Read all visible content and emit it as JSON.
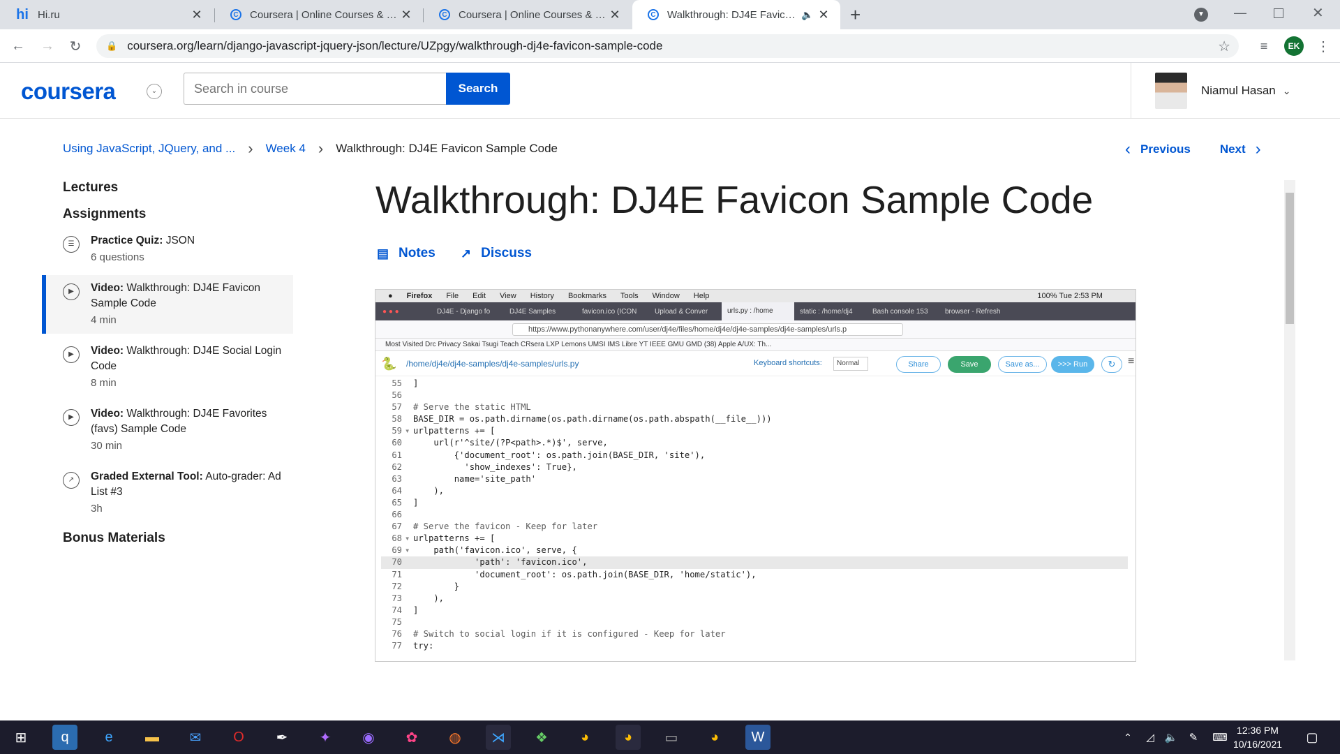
{
  "browser": {
    "tabs": [
      {
        "title": "Hi.ru",
        "favicon": "hi-logo"
      },
      {
        "title": "Coursera | Online Courses & Credentials",
        "favicon": "coursera-icon"
      },
      {
        "title": "Coursera | Online Courses & Credentials",
        "favicon": "coursera-icon"
      },
      {
        "title": "Walkthrough: DJ4E Favicon Sample Code",
        "favicon": "coursera-icon",
        "active": true
      }
    ],
    "url": "coursera.org/learn/django-javascript-jquery-json/lecture/UZpgy/walkthrough-dj4e-favicon-sample-code",
    "profile_initials": "EK"
  },
  "header": {
    "logo": "coursera",
    "search_placeholder": "Search in course",
    "search_button": "Search",
    "user_name": "Niamul Hasan"
  },
  "breadcrumb": {
    "course": "Using JavaScript, JQuery, and ...",
    "week": "Week 4",
    "current": "Walkthrough: DJ4E Favicon Sample Code"
  },
  "nav": {
    "previous": "Previous",
    "next": "Next"
  },
  "sidebar": {
    "lectures": "Lectures",
    "assignments": "Assignments",
    "bonus": "Bonus Materials",
    "items": [
      {
        "type": "Practice Quiz:",
        "name": "JSON",
        "meta": "6 questions",
        "icon": "quiz-icon"
      },
      {
        "type": "Video:",
        "name": "Walkthrough: DJ4E Favicon Sample Code",
        "meta": "4 min",
        "icon": "play-icon",
        "active": true
      },
      {
        "type": "Video:",
        "name": "Walkthrough: DJ4E Social Login Code",
        "meta": "8 min",
        "icon": "play-icon"
      },
      {
        "type": "Video:",
        "name": "Walkthrough: DJ4E Favorites (favs) Sample Code",
        "meta": "30 min",
        "icon": "play-icon"
      },
      {
        "type": "Graded External Tool:",
        "name": "Auto-grader: Ad List #3",
        "meta": "3h",
        "icon": "external-tool-icon"
      }
    ]
  },
  "main": {
    "title": "Walkthrough: DJ4E Favicon Sample Code",
    "notes": "Notes",
    "discuss": "Discuss"
  },
  "video": {
    "mac_menu": [
      "Firefox",
      "File",
      "Edit",
      "View",
      "History",
      "Bookmarks",
      "Tools",
      "Window",
      "Help"
    ],
    "mac_status": "100%   Tue 2:53 PM",
    "ff_tabs": [
      "DJ4E - Django fo",
      "DJ4E Samples",
      "favicon.ico (ICON",
      "Upload & Conver",
      "urls.py : /home",
      "static : /home/dj4",
      "Bash console 153",
      "browser - Refresh"
    ],
    "ff_url": "https://www.pythonanywhere.com/user/dj4e/files/home/dj4e/dj4e-samples/dj4e-samples/urls.p",
    "bookmarks": "Most Visited   Drc   Privacy   Sakai   Tsugi   Teach   CRsera   LXP   Lemons   UMSI   IMS   Libre   YT   IEEE   GMU   GMD   (38) Apple A/UX: Th...",
    "pa_path": "/home/dj4e/dj4e-samples/dj4e-samples/urls.py",
    "pa_kb": "Keyboard shortcuts:",
    "pa_mode": "Normal",
    "pa_share": "Share",
    "pa_save": "Save",
    "pa_saveas": "Save as...",
    "pa_run": ">>> Run",
    "code": [
      {
        "n": "55",
        "t": "]"
      },
      {
        "n": "56",
        "t": ""
      },
      {
        "n": "57",
        "t": "# Serve the static HTML",
        "c": "cmt"
      },
      {
        "n": "58",
        "t": "BASE_DIR = os.path.dirname(os.path.dirname(os.path.abspath(__file__)))"
      },
      {
        "n": "59",
        "t": "urlpatterns += [",
        "f": true
      },
      {
        "n": "60",
        "t": "    url(r'^site/(?P<path>.*)$', serve,"
      },
      {
        "n": "61",
        "t": "        {'document_root': os.path.join(BASE_DIR, 'site'),"
      },
      {
        "n": "62",
        "t": "          'show_indexes': True},"
      },
      {
        "n": "63",
        "t": "        name='site_path'"
      },
      {
        "n": "64",
        "t": "    ),"
      },
      {
        "n": "65",
        "t": "]"
      },
      {
        "n": "66",
        "t": ""
      },
      {
        "n": "67",
        "t": "# Serve the favicon - Keep for later",
        "c": "cmt"
      },
      {
        "n": "68",
        "t": "urlpatterns += [",
        "f": true
      },
      {
        "n": "69",
        "t": "    path('favicon.ico', serve, {",
        "f": true
      },
      {
        "n": "70",
        "t": "            'path': 'favicon.ico',",
        "hl": true
      },
      {
        "n": "71",
        "t": "            'document_root': os.path.join(BASE_DIR, 'home/static'),"
      },
      {
        "n": "72",
        "t": "        }"
      },
      {
        "n": "73",
        "t": "    ),"
      },
      {
        "n": "74",
        "t": "]"
      },
      {
        "n": "75",
        "t": ""
      },
      {
        "n": "76",
        "t": "# Switch to social login if it is configured - Keep for later",
        "c": "cmt"
      },
      {
        "n": "77",
        "t": "try:"
      }
    ]
  },
  "taskbar": {
    "time": "12:36 PM",
    "date": "10/16/2021"
  }
}
